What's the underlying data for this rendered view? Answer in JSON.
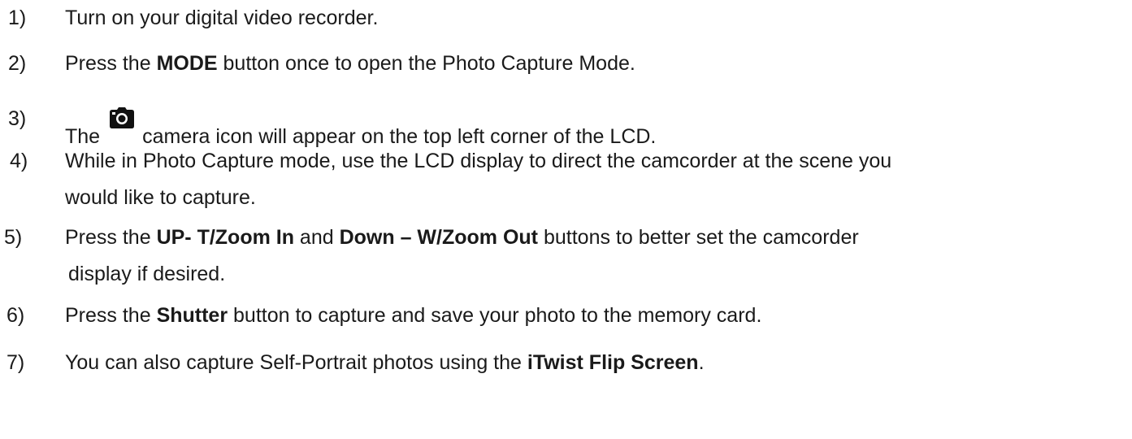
{
  "steps": [
    {
      "num": "1)",
      "parts": [
        "Turn on your digital video recorder."
      ]
    },
    {
      "num": "2)",
      "parts": [
        "Press the ",
        "MODE",
        " button once to open the Photo Capture Mode."
      ]
    },
    {
      "num": "3)",
      "parts": [
        "The",
        "camera icon will appear on the top left corner of the LCD."
      ],
      "icon": "camera-icon"
    },
    {
      "num": "4)",
      "line1": "While in Photo Capture mode, use the LCD display to direct the camcorder at the scene you",
      "line2": "would like to capture."
    },
    {
      "num": "5)",
      "line1_parts": [
        "Press the ",
        "UP- T/Zoom In",
        " and ",
        "Down – W/Zoom Out",
        " buttons to better set the camcorder"
      ],
      "line2": "display if desired."
    },
    {
      "num": "6)",
      "parts": [
        "Press the ",
        "Shutter",
        " button to capture and save your photo to the memory card."
      ]
    },
    {
      "num": "7)",
      "parts": [
        "You can also capture Self-Portrait photos using the ",
        "iTwist Flip Screen",
        "."
      ]
    }
  ]
}
